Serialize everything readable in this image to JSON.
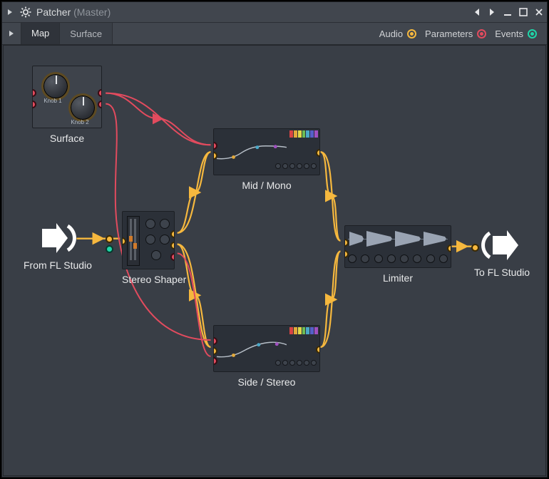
{
  "window": {
    "title": "Patcher",
    "context": "(Master)"
  },
  "tabs": {
    "map": "Map",
    "surface": "Surface",
    "active": "map"
  },
  "legend": {
    "audio": "Audio",
    "parameters": "Parameters",
    "events": "Events"
  },
  "colors": {
    "audio": "#f6b83e",
    "parameter": "#e24b5e",
    "event": "#1fd6a8"
  },
  "nodes": {
    "surface": {
      "label": "Surface",
      "knobs": [
        "Knob 1",
        "Knob 2"
      ]
    },
    "from": {
      "label": "From FL Studio"
    },
    "shaper": {
      "label": "Stereo Shaper"
    },
    "mid": {
      "label": "Mid / Mono"
    },
    "side": {
      "label": "Side / Stereo"
    },
    "limiter": {
      "label": "Limiter"
    },
    "to": {
      "label": "To FL Studio"
    }
  },
  "connections": [
    {
      "from": "from",
      "to": "shaper",
      "type": "audio"
    },
    {
      "from": "shaper",
      "to": "mid",
      "type": "audio"
    },
    {
      "from": "shaper",
      "to": "side",
      "type": "audio"
    },
    {
      "from": "mid",
      "to": "limiter",
      "type": "audio"
    },
    {
      "from": "side",
      "to": "limiter",
      "type": "audio"
    },
    {
      "from": "limiter",
      "to": "to",
      "type": "audio"
    },
    {
      "from": "surface",
      "to": "mid",
      "type": "parameter"
    },
    {
      "from": "surface",
      "to": "side",
      "type": "parameter"
    },
    {
      "from": "shaper",
      "to": "side",
      "type": "parameter"
    }
  ]
}
